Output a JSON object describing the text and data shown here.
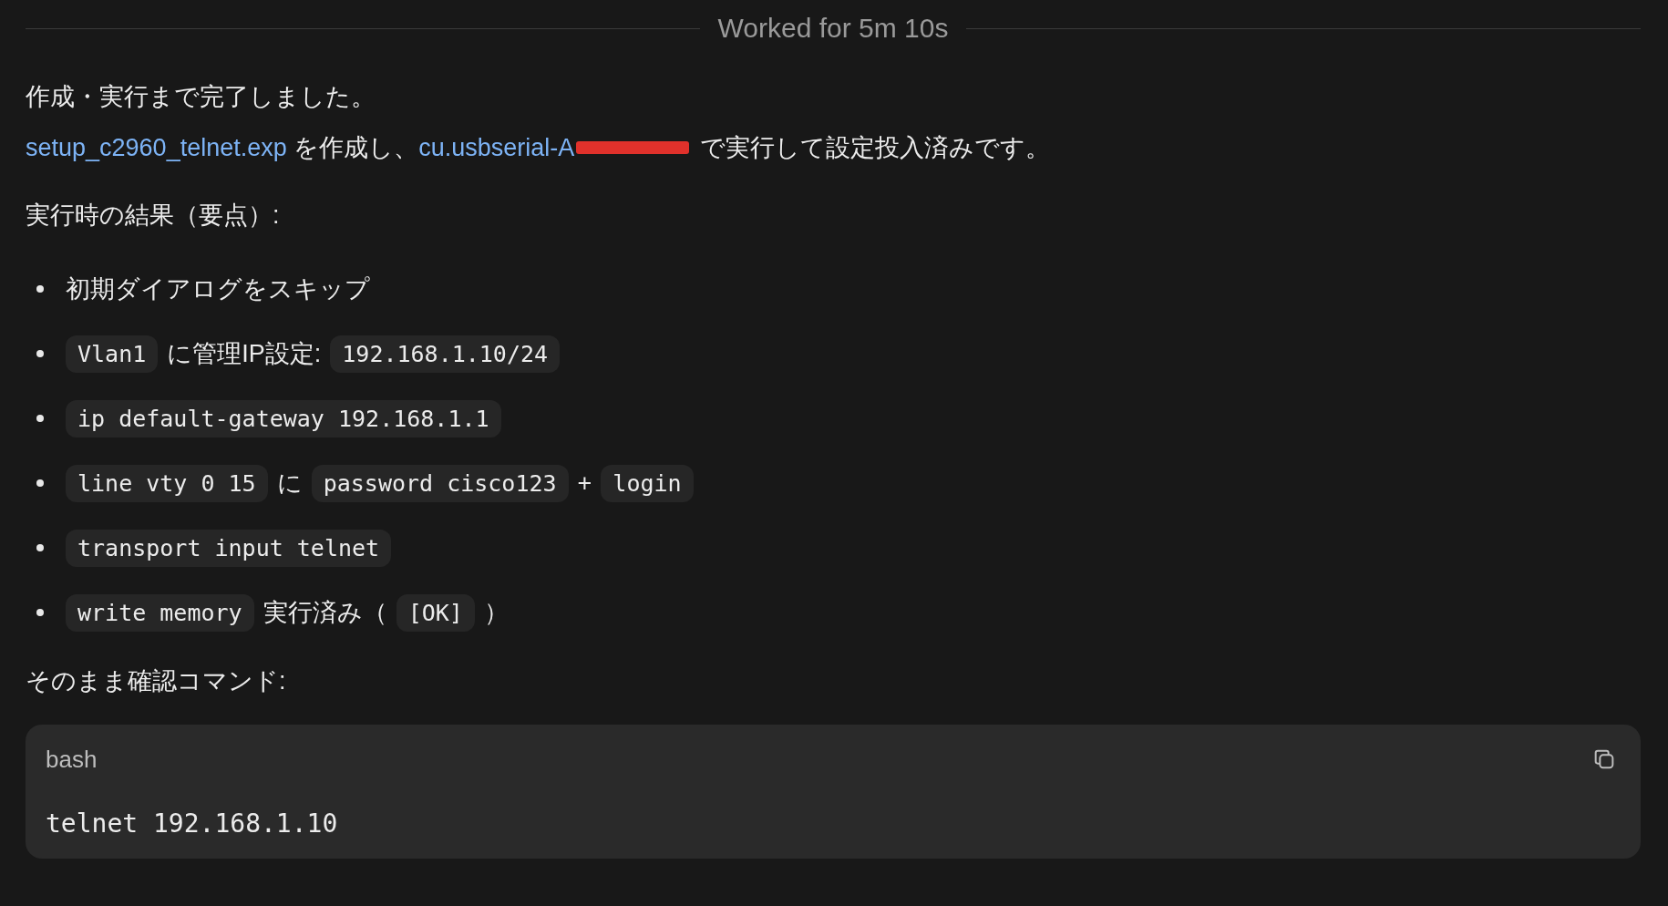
{
  "header": {
    "label": "Worked for 5m 10s"
  },
  "message": {
    "intro": "作成・実行まで完了しました。",
    "summary": [
      {
        "kind": "link",
        "text": "setup_c2960_telnet.exp"
      },
      {
        "kind": "text",
        "text": " を作成し、"
      },
      {
        "kind": "link",
        "text": "cu.usbserial-A"
      },
      {
        "kind": "redaction"
      },
      {
        "kind": "text",
        "text": " で実行して設定投入済みです。"
      }
    ],
    "heading": "実行時の結果（要点）:",
    "bullets": [
      [
        {
          "kind": "text",
          "text": "初期ダイアログをスキップ"
        }
      ],
      [
        {
          "kind": "code",
          "text": "Vlan1"
        },
        {
          "kind": "text",
          "text": "に管理IP設定:"
        },
        {
          "kind": "code",
          "text": "192.168.1.10/24"
        }
      ],
      [
        {
          "kind": "code",
          "text": "ip default-gateway 192.168.1.1"
        }
      ],
      [
        {
          "kind": "code",
          "text": "line vty 0 15"
        },
        {
          "kind": "text",
          "text": "に"
        },
        {
          "kind": "code",
          "text": "password cisco123"
        },
        {
          "kind": "text",
          "text": "+"
        },
        {
          "kind": "code",
          "text": "login"
        }
      ],
      [
        {
          "kind": "code",
          "text": "transport input telnet"
        }
      ],
      [
        {
          "kind": "code",
          "text": "write memory"
        },
        {
          "kind": "text",
          "text": "実行済み（"
        },
        {
          "kind": "code",
          "text": "[OK]"
        },
        {
          "kind": "text",
          "text": "）"
        }
      ]
    ],
    "command_label": "そのまま確認コマンド:",
    "code_block": {
      "language": "bash",
      "code": "telnet 192.168.1.10"
    }
  }
}
